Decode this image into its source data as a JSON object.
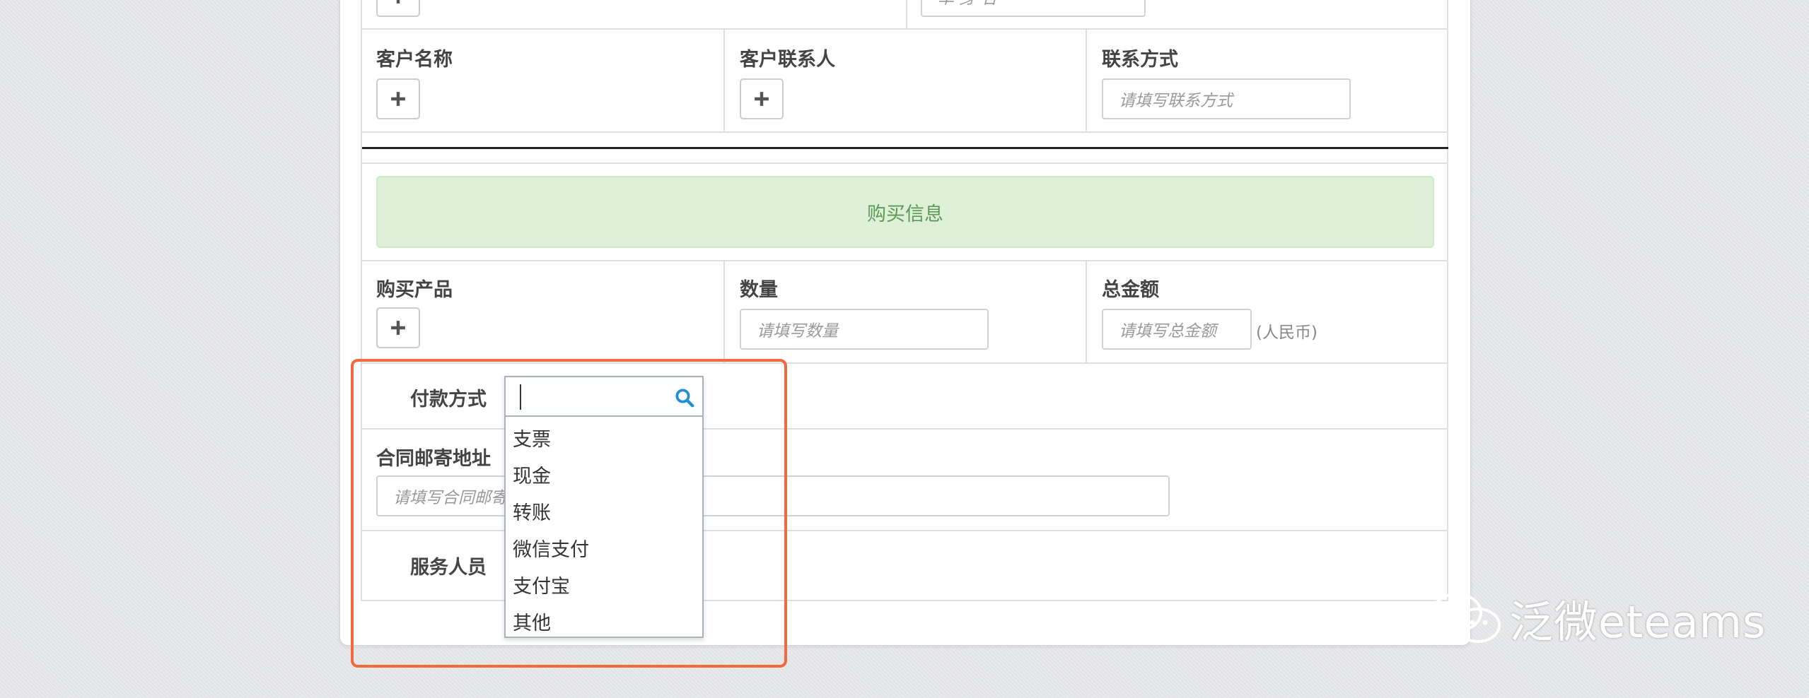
{
  "top_partial": {
    "placeholder": "单  身  名"
  },
  "customer": {
    "name_label": "客户名称",
    "contact_label": "客户联系人",
    "contact_method_label": "联系方式",
    "contact_method_placeholder": "请填写联系方式"
  },
  "purchase": {
    "banner": "购买信息",
    "product_label": "购买产品",
    "quantity_label": "数量",
    "quantity_placeholder": "请填写数量",
    "total_label": "总金额",
    "total_placeholder": "请填写总金额",
    "total_unit": "(人民币)"
  },
  "payment": {
    "label": "付款方式",
    "search_value": "",
    "options": [
      "支票",
      "现金",
      "转账",
      "微信支付",
      "支付宝",
      "其他"
    ]
  },
  "contract": {
    "address_label": "合同邮寄地址",
    "address_placeholder": "请填写合同邮寄地址"
  },
  "service": {
    "label": "服务人员"
  },
  "watermark": "泛微eteams",
  "colors": {
    "banner_bg": "#dff0d8",
    "banner_text": "#5b9a54",
    "highlight": "#f26a3b"
  }
}
